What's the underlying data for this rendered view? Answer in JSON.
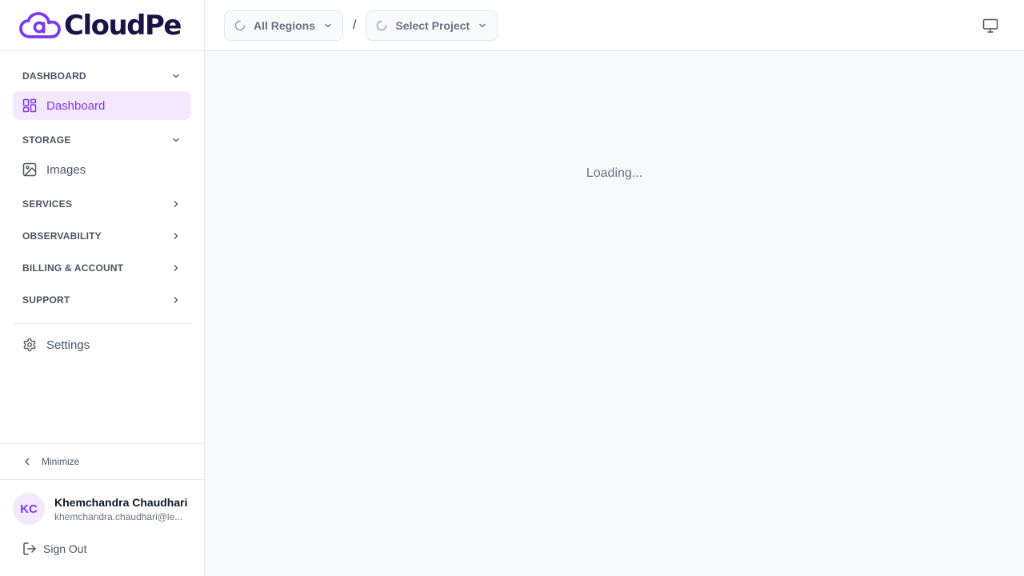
{
  "brand": {
    "name": "CloudPe",
    "accent": "#7c3aed",
    "dark": "#1a1446"
  },
  "sidebar": {
    "sections": {
      "dashboard": {
        "label": "DASHBOARD",
        "state": "expanded",
        "items": [
          {
            "label": "Dashboard",
            "icon": "dashboard-grid-icon",
            "active": true
          }
        ]
      },
      "storage": {
        "label": "STORAGE",
        "state": "expanded",
        "items": [
          {
            "label": "Images",
            "icon": "image-icon"
          }
        ]
      },
      "services": {
        "label": "SERVICES",
        "state": "collapsed"
      },
      "observability": {
        "label": "OBSERVABILITY",
        "state": "collapsed"
      },
      "billing": {
        "label": "BILLING & ACCOUNT",
        "state": "collapsed"
      },
      "support": {
        "label": "SUPPORT",
        "state": "collapsed"
      }
    },
    "settings_label": "Settings",
    "minimize_label": "Minimize"
  },
  "user": {
    "initials": "KC",
    "name": "Khemchandra Chaudhari",
    "email": "khemchandra.chaudhari@le..."
  },
  "signout_label": "Sign Out",
  "topbar": {
    "region_label": "All Regions",
    "separator": "/",
    "project_label": "Select Project"
  },
  "main": {
    "loading_text": "Loading..."
  }
}
